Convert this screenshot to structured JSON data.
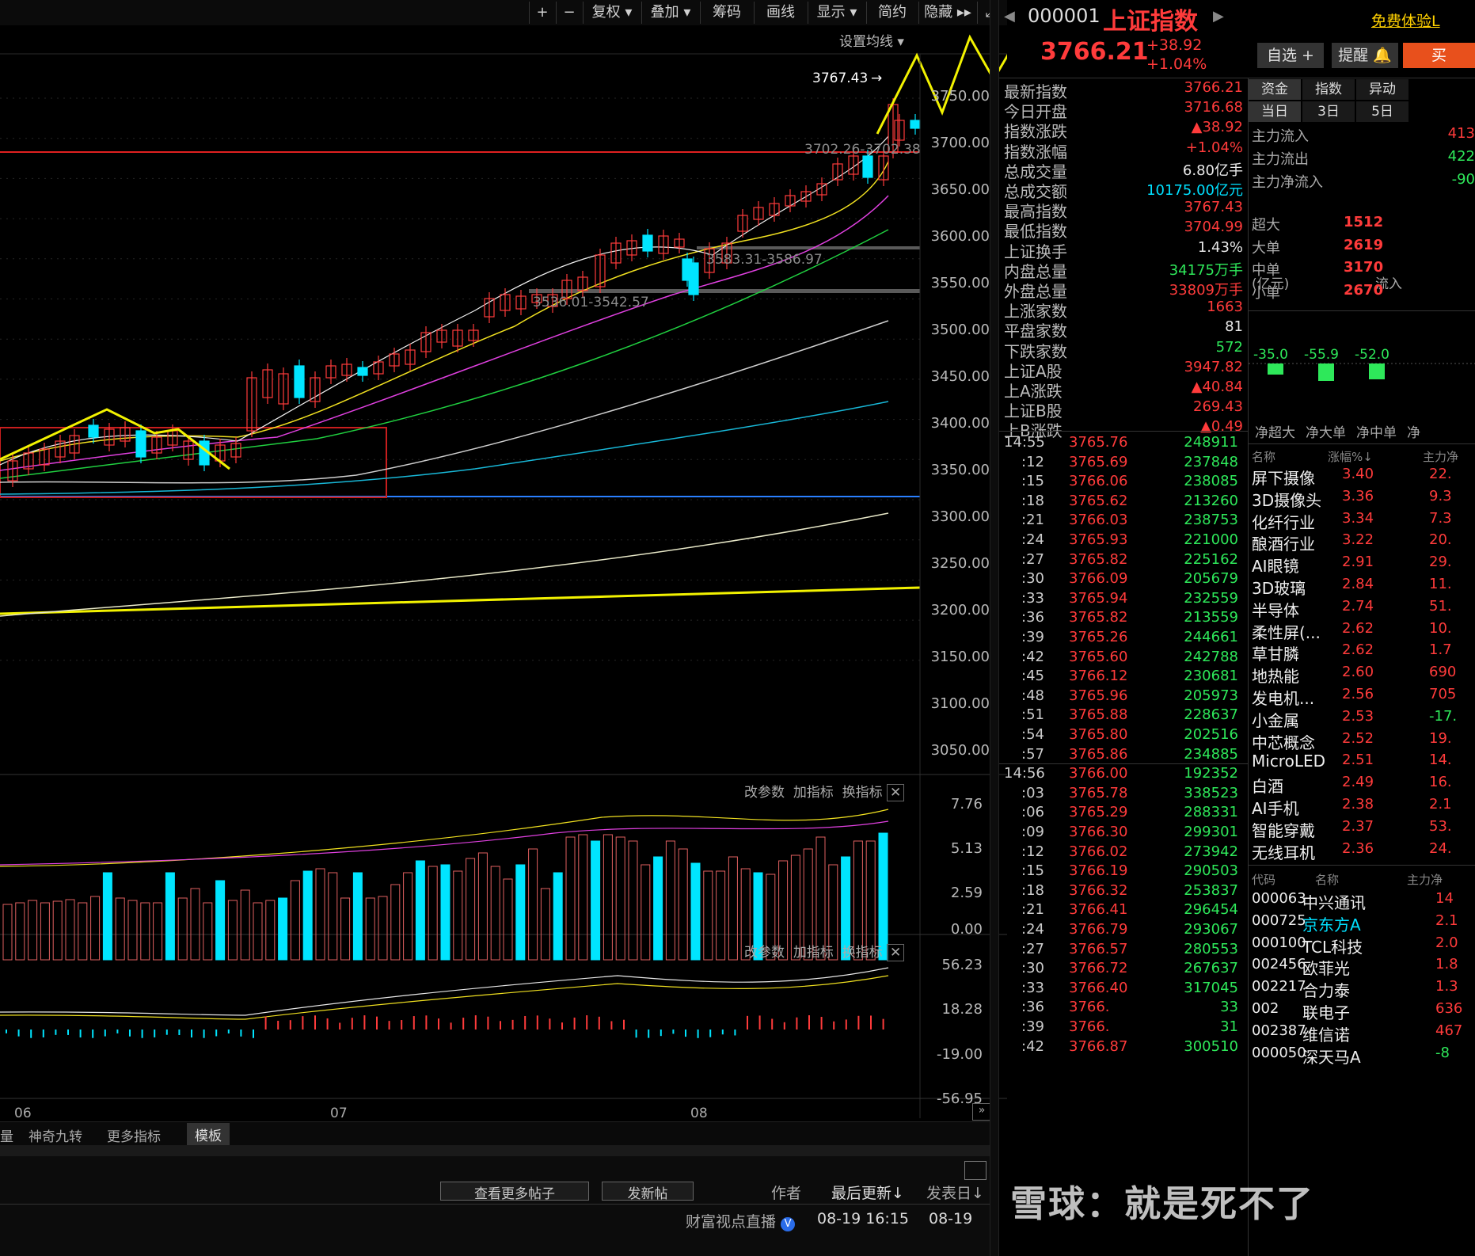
{
  "toolbar": {
    "plus": "+",
    "minus": "−",
    "fuquan": "复权",
    "diejia": "叠加",
    "chouma": "筹码",
    "huaxian": "画线",
    "xianshi": "显示",
    "jianyue": "简约",
    "yincang": "隐藏",
    "expand": "⤢"
  },
  "setting_ma": "设置均线",
  "price_axis": [
    "3750.00",
    "3700.00",
    "3650.00",
    "3600.00",
    "3550.00",
    "3500.00",
    "3450.00",
    "3400.00",
    "3350.00",
    "3300.00",
    "3250.00",
    "3200.00",
    "3150.00",
    "3100.00",
    "3050.00"
  ],
  "annotations": {
    "high": "3767.43",
    "gap1": "3702.26-3702.38",
    "gap2": "3583.31-3586.97",
    "gap3": "3536.01-3542.57"
  },
  "vol_panel": {
    "tools": [
      "改参数",
      "加指标",
      "换指标"
    ],
    "axis": [
      "7.76",
      "5.13",
      "2.59",
      "0.00"
    ]
  },
  "ind_panel": {
    "tools": [
      "改参数",
      "加指标",
      "换指标"
    ],
    "axis": [
      "56.23",
      "18.28",
      "-19.00",
      "-56.95"
    ]
  },
  "months": [
    "06",
    "07",
    "08"
  ],
  "bottom_tabs": [
    "量",
    "神奇九转",
    "更多指标",
    "模板"
  ],
  "forum": {
    "more_posts": "查看更多帖子",
    "new_post": "发新帖",
    "author": "作者",
    "last_update": "最后更新↓",
    "post_date": "发表日↓",
    "live": "财富视点直播",
    "date1": "08-19 16:15",
    "date2": "08-19"
  },
  "quote": {
    "code": "000001",
    "name": "上证指数",
    "price": "3766.21",
    "change": "+38.92",
    "pct": "+1.04%",
    "free_trial": "免费体验L",
    "zixuan": "自选 +",
    "remind": "提醒",
    "buy": "买"
  },
  "stats": [
    {
      "label": "最新指数",
      "value": "3766.21",
      "color": "red"
    },
    {
      "label": "今日开盘",
      "value": "3716.68",
      "color": "red"
    },
    {
      "label": "指数涨跌",
      "value": "▲38.92",
      "color": "red"
    },
    {
      "label": "指数涨幅",
      "value": "+1.04%",
      "color": "red"
    },
    {
      "label": "总成交量",
      "value": "6.80亿手",
      "color": "white"
    },
    {
      "label": "总成交额",
      "value": "10175.00亿元",
      "color": "cyan"
    },
    {
      "label": "最高指数",
      "value": "3767.43",
      "color": "red"
    },
    {
      "label": "最低指数",
      "value": "3704.99",
      "color": "red"
    },
    {
      "label": "上证换手",
      "value": "1.43%",
      "color": "white"
    },
    {
      "label": "内盘总量",
      "value": "34175万手",
      "color": "green"
    },
    {
      "label": "外盘总量",
      "value": "33809万手",
      "color": "red"
    },
    {
      "label": "上涨家数",
      "value": "1663",
      "color": "red"
    },
    {
      "label": "平盘家数",
      "value": "81",
      "color": "white"
    },
    {
      "label": "下跌家数",
      "value": "572",
      "color": "green"
    },
    {
      "label": "上证A股",
      "value": "3947.82",
      "color": "red"
    },
    {
      "label": "上A涨跌",
      "value": "▲40.84",
      "color": "red"
    },
    {
      "label": "上证B股",
      "value": "269.43",
      "color": "red"
    },
    {
      "label": "上B涨跌",
      "value": "▲0.49",
      "color": "red"
    }
  ],
  "ticks": [
    {
      "t": "14:55",
      "p": "3765.76",
      "v": "248911"
    },
    {
      "t": ":12",
      "p": "3765.69",
      "v": "237848"
    },
    {
      "t": ":15",
      "p": "3766.06",
      "v": "238085"
    },
    {
      "t": ":18",
      "p": "3765.62",
      "v": "213260"
    },
    {
      "t": ":21",
      "p": "3766.03",
      "v": "238753"
    },
    {
      "t": ":24",
      "p": "3765.93",
      "v": "221000"
    },
    {
      "t": ":27",
      "p": "3765.82",
      "v": "225162"
    },
    {
      "t": ":30",
      "p": "3766.09",
      "v": "205679"
    },
    {
      "t": ":33",
      "p": "3765.94",
      "v": "232559"
    },
    {
      "t": ":36",
      "p": "3765.82",
      "v": "213559"
    },
    {
      "t": ":39",
      "p": "3765.26",
      "v": "244661"
    },
    {
      "t": ":42",
      "p": "3765.60",
      "v": "242788"
    },
    {
      "t": ":45",
      "p": "3766.12",
      "v": "230681"
    },
    {
      "t": ":48",
      "p": "3765.96",
      "v": "205973"
    },
    {
      "t": ":51",
      "p": "3765.88",
      "v": "228637"
    },
    {
      "t": ":54",
      "p": "3765.80",
      "v": "202516"
    },
    {
      "t": ":57",
      "p": "3765.86",
      "v": "234885"
    },
    {
      "t": "14:56",
      "p": "3766.00",
      "v": "192352"
    },
    {
      "t": ":03",
      "p": "3765.78",
      "v": "338523"
    },
    {
      "t": ":06",
      "p": "3765.29",
      "v": "288331"
    },
    {
      "t": ":09",
      "p": "3766.30",
      "v": "299301"
    },
    {
      "t": ":12",
      "p": "3766.02",
      "v": "273942"
    },
    {
      "t": ":15",
      "p": "3766.19",
      "v": "290503"
    },
    {
      "t": ":18",
      "p": "3766.32",
      "v": "253837"
    },
    {
      "t": ":21",
      "p": "3766.41",
      "v": "296454"
    },
    {
      "t": ":24",
      "p": "3766.79",
      "v": "293067"
    },
    {
      "t": ":27",
      "p": "3766.57",
      "v": "280553"
    },
    {
      "t": ":30",
      "p": "3766.72",
      "v": "267637"
    },
    {
      "t": ":33",
      "p": "3766.40",
      "v": "317045"
    },
    {
      "t": ":36",
      "p": "3766.",
      "v": "33"
    },
    {
      "t": ":39",
      "p": "3766.",
      "v": "31"
    },
    {
      "t": ":42",
      "p": "3766.87",
      "v": "300510"
    }
  ],
  "flow": {
    "tabs1": [
      "资金",
      "指数",
      "异动"
    ],
    "tabs2": [
      "当日",
      "3日",
      "5日"
    ],
    "rows": [
      {
        "l": "主力流入",
        "v": "413",
        "c": "red"
      },
      {
        "l": "主力流出",
        "v": "422",
        "c": "green"
      },
      {
        "l": "主力净流入",
        "v": "-90",
        "c": "green"
      }
    ],
    "unit": "(亿元)",
    "inflow": "流入",
    "sizes": [
      {
        "l": "超大",
        "v": "1512"
      },
      {
        "l": "大单",
        "v": "2619"
      },
      {
        "l": "中单",
        "v": "3170"
      },
      {
        "l": "小单",
        "v": "2670"
      }
    ],
    "net": [
      {
        "v": "-35.0",
        "h": 14
      },
      {
        "v": "-55.9",
        "h": 22
      },
      {
        "v": "-52.0",
        "h": 20
      }
    ],
    "net_labels": [
      "净超大",
      "净大单",
      "净中单",
      "净"
    ]
  },
  "sectors": {
    "headers": [
      "名称",
      "涨幅%↓",
      "主力净"
    ],
    "rows": [
      {
        "n": "屏下摄像",
        "p": "3.40",
        "m": "22."
      },
      {
        "n": "3D摄像头",
        "p": "3.36",
        "m": "9.3"
      },
      {
        "n": "化纤行业",
        "p": "3.34",
        "m": "7.3"
      },
      {
        "n": "酿酒行业",
        "p": "3.22",
        "m": "20."
      },
      {
        "n": "AI眼镜",
        "p": "2.91",
        "m": "29."
      },
      {
        "n": "3D玻璃",
        "p": "2.84",
        "m": "11."
      },
      {
        "n": "半导体",
        "p": "2.74",
        "m": "51."
      },
      {
        "n": "柔性屏(...",
        "p": "2.62",
        "m": "10."
      },
      {
        "n": "草甘膦",
        "p": "2.62",
        "m": "1.7"
      },
      {
        "n": "地热能",
        "p": "2.60",
        "m": "690"
      },
      {
        "n": "发电机...",
        "p": "2.56",
        "m": "705"
      },
      {
        "n": "小金属",
        "p": "2.53",
        "m": "-17."
      },
      {
        "n": "中芯概念",
        "p": "2.52",
        "m": "19."
      },
      {
        "n": "MicroLED",
        "p": "2.51",
        "m": "14."
      },
      {
        "n": "白酒",
        "p": "2.49",
        "m": "16."
      },
      {
        "n": "AI手机",
        "p": "2.38",
        "m": "2.1"
      },
      {
        "n": "智能穿戴",
        "p": "2.37",
        "m": "53."
      },
      {
        "n": "无线耳机",
        "p": "2.36",
        "m": "24."
      }
    ]
  },
  "stocks": {
    "headers": [
      "代码",
      "名称",
      "主力净"
    ],
    "rows": [
      {
        "c": "000063",
        "n": "中兴通讯",
        "m": "14"
      },
      {
        "c": "000725",
        "n": "京东方A",
        "m": "2.1"
      },
      {
        "c": "000100",
        "n": "TCL科技",
        "m": "2.0"
      },
      {
        "c": "002456",
        "n": "欧菲光",
        "m": "1.8"
      },
      {
        "c": "002217",
        "n": "合力泰",
        "m": "1.3"
      },
      {
        "c": "002",
        "n": "联电子",
        "m": "636"
      },
      {
        "c": "002387",
        "n": "维信诺",
        "m": "467"
      },
      {
        "c": "000050",
        "n": "深天马A",
        "m": "-8"
      }
    ]
  },
  "watermark": "雪球：就是死不了",
  "colors": {
    "up": "#ff3b3b",
    "down": "#2ee85a",
    "cyan": "#00e5ff",
    "yellow": "#ffff00"
  }
}
